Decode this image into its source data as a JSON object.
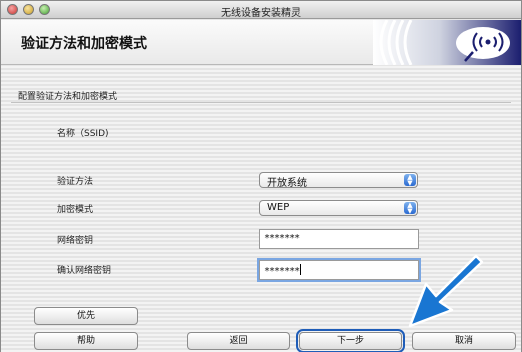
{
  "window": {
    "title": "无线设备安装精灵"
  },
  "header": {
    "title": "验证方法和加密模式"
  },
  "section": {
    "title": "配置验证方法和加密模式"
  },
  "form": {
    "ssid_label": "名称（SSID)",
    "auth_label": "验证方法",
    "auth_value": "开放系统",
    "encryption_label": "加密模式",
    "encryption_value": "WEP",
    "key_label": "网络密钥",
    "key_value": "*******",
    "confirm_key_label": "确认网络密钥",
    "confirm_key_value": "*******"
  },
  "buttons": {
    "priority": "优先",
    "help": "帮助",
    "back": "返回",
    "next": "下一步",
    "cancel": "取消"
  },
  "colors": {
    "accent": "#1f5db8",
    "arrow": "#1976d2"
  }
}
